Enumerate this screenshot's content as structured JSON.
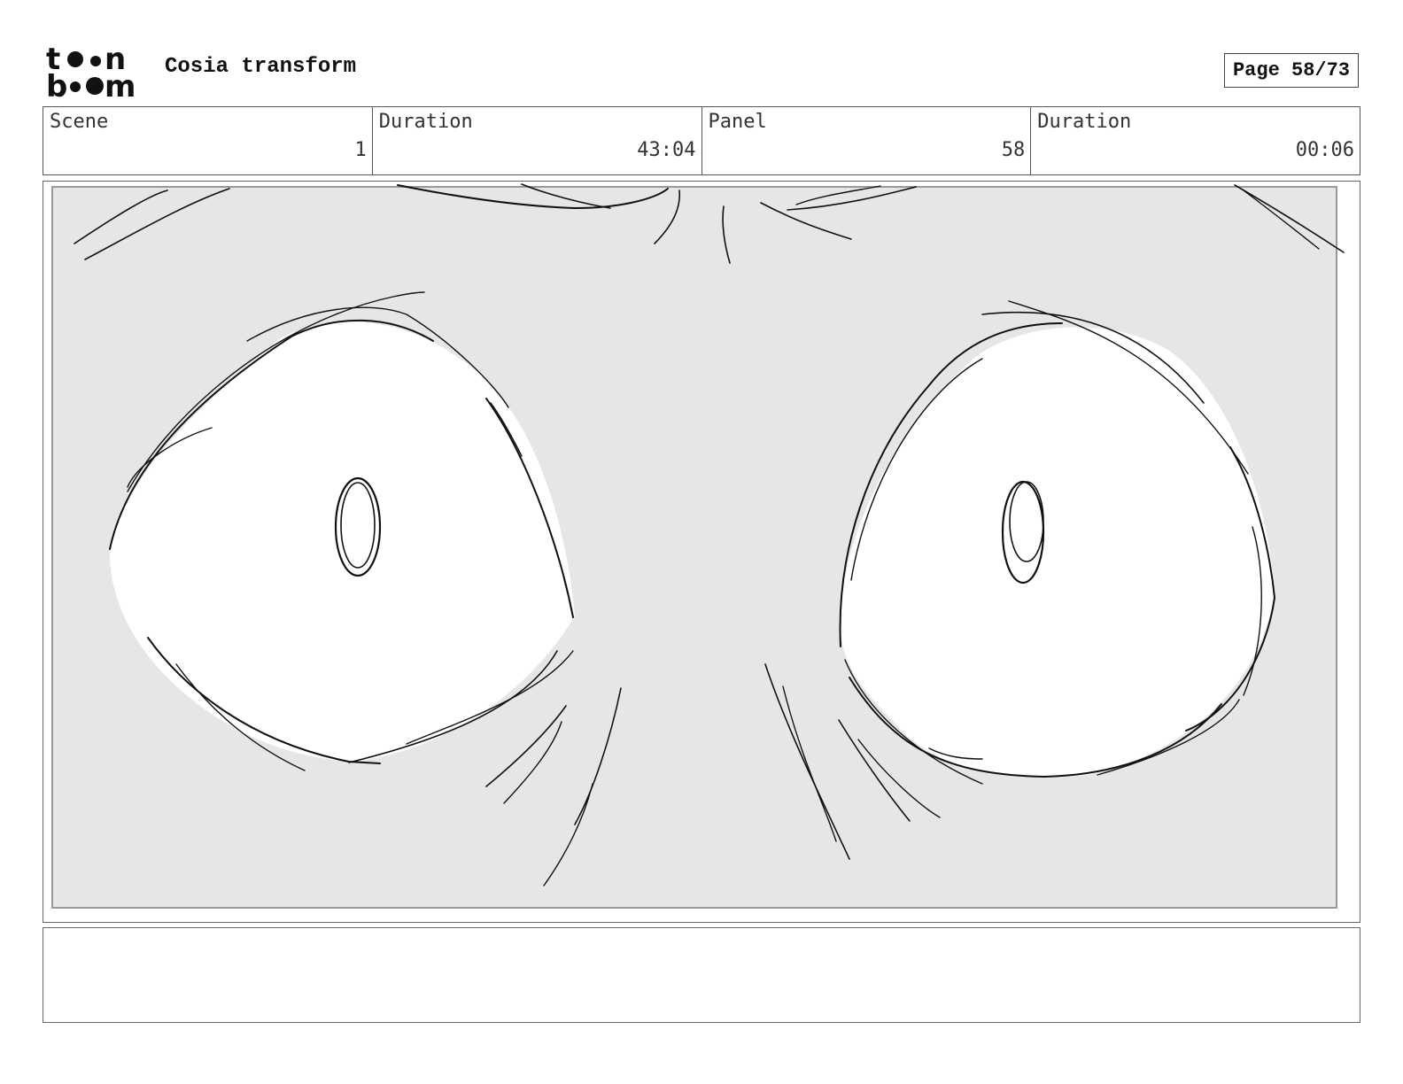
{
  "header": {
    "logo_line1": "toon",
    "logo_line2": "boom",
    "project_title": "Cosia transform",
    "page_indicator": "Page 58/73"
  },
  "info": {
    "scene_label": "Scene",
    "scene_value": "1",
    "scene_duration_label": "Duration",
    "scene_duration_value": "43:04",
    "panel_label": "Panel",
    "panel_value": "58",
    "panel_duration_label": "Duration",
    "panel_duration_value": "00:06"
  },
  "panel": {
    "background_color": "#e6e6e6",
    "stroke_color": "#111111"
  },
  "notes": {
    "text": ""
  }
}
